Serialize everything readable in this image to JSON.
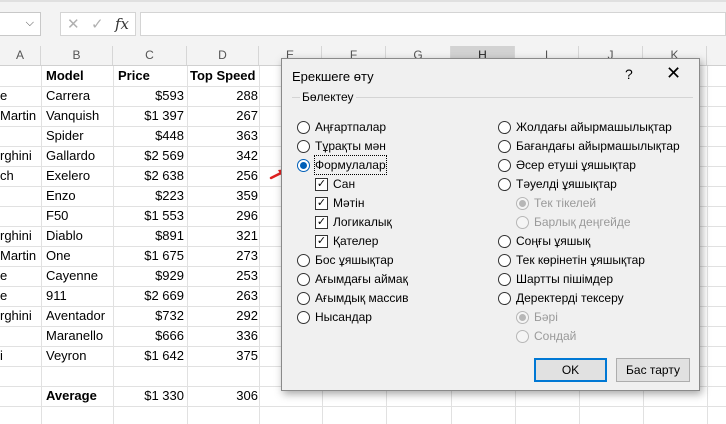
{
  "formula_bar": {
    "name_box": "",
    "cancel_icon": "✕",
    "enter_icon": "✓",
    "fx_label": "fx",
    "formula": ""
  },
  "columns": [
    "A",
    "B",
    "C",
    "D",
    "E",
    "F",
    "G",
    "H",
    "I",
    "J",
    "K"
  ],
  "selected_column": "H",
  "table": {
    "headers": [
      "",
      "Model",
      "Price",
      "Top Speed"
    ],
    "rows": [
      [
        "e",
        "Carrera",
        "$593",
        "288"
      ],
      [
        "Martin",
        "Vanquish",
        "$1 397",
        "267"
      ],
      [
        "",
        "Spider",
        "$448",
        "363"
      ],
      [
        "rghini",
        "Gallardo",
        "$2 569",
        "342"
      ],
      [
        "ch",
        "Exelero",
        "$2 638",
        "256"
      ],
      [
        "",
        "Enzo",
        "$223",
        "359"
      ],
      [
        "",
        "F50",
        "$1 553",
        "296"
      ],
      [
        "rghini",
        "Diablo",
        "$891",
        "321"
      ],
      [
        "Martin",
        "One",
        "$1 675",
        "273"
      ],
      [
        "e",
        "Cayenne",
        "$929",
        "253"
      ],
      [
        "e",
        "911",
        "$2 669",
        "263"
      ],
      [
        "rghini",
        "Aventador",
        "$732",
        "292"
      ],
      [
        "",
        "Maranello",
        "$666",
        "336"
      ],
      [
        "i",
        "Veyron",
        "$1 642",
        "375"
      ]
    ],
    "average": {
      "label": "Average",
      "price": "$1 330",
      "speed": "306"
    }
  },
  "dialog": {
    "title": "Ерекшеге өту",
    "help": "?",
    "close": "✕",
    "group_label": "Бөлектеу",
    "left_options": [
      "Аңғартпалар",
      "Тұрақты мән",
      "Формулалар",
      "Сан",
      "Мәтін",
      "Логикалық",
      "Қателер",
      "Бос ұяшықтар",
      "Ағымдағы аймақ",
      "Ағымдық массив",
      "Нысандар"
    ],
    "right_options": [
      "Жолдағы айырмашылықтар",
      "Бағандағы айырмашылықтар",
      "Әсер етуші ұяшықтар",
      "Тәуелді ұяшықтар",
      "Тек тікелей",
      "Барлық деңгейде",
      "Соңғы ұяшық",
      "Тек көрінетін ұяшықтар",
      "Шартты пішімдер",
      "Деректерді тексеру",
      "Бәрі",
      "Сондай"
    ],
    "selected_option": "Формулалар",
    "ok_label": "OK",
    "cancel_label": "Бас тарту"
  },
  "colors": {
    "accent": "#0078d4",
    "selected_header": "#217346",
    "arrow": "#e02020"
  }
}
